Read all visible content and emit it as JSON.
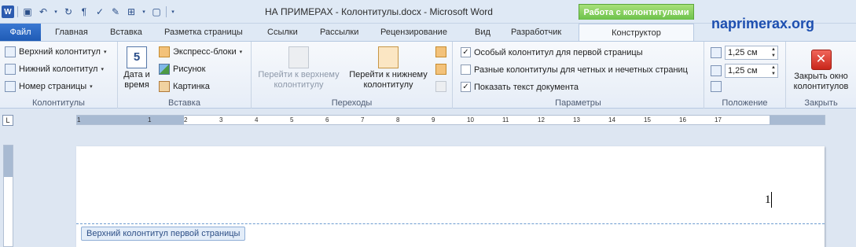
{
  "window": {
    "title": "НА ПРИМЕРАХ - Колонтитулы.docx  -  Microsoft Word",
    "context_tab_header": "Работа с колонтитулами",
    "brand": "naprimerax.org",
    "app_icon_letter": "W"
  },
  "tabs": {
    "file": "Файл",
    "items": [
      "Главная",
      "Вставка",
      "Разметка страницы",
      "Ссылки",
      "Рассылки",
      "Рецензирование",
      "Вид",
      "Разработчик",
      "Конструктор"
    ]
  },
  "ribbon": {
    "headers_footers": {
      "label": "Колонтитулы",
      "header": "Верхний колонтитул",
      "footer": "Нижний колонтитул",
      "page_number": "Номер страницы"
    },
    "insert": {
      "label": "Вставка",
      "date_time": "Дата и время",
      "date_time_line1": "Дата и",
      "date_time_line2": "время",
      "quick_parts": "Экспресс-блоки",
      "picture": "Рисунок",
      "clip_art": "Картинка",
      "calendar_number": "5"
    },
    "navigation": {
      "label": "Переходы",
      "goto_header_line1": "Перейти к верхнему",
      "goto_header_line2": "колонтитулу",
      "goto_footer_line1": "Перейти к нижнему",
      "goto_footer_line2": "колонтитулу"
    },
    "options": {
      "label": "Параметры",
      "different_first": "Особый колонтитул для первой страницы",
      "different_odd_even": "Разные колонтитулы для четных и нечетных страниц",
      "show_document_text": "Показать текст документа",
      "different_first_checked": true,
      "different_odd_even_checked": false,
      "show_document_text_checked": true
    },
    "position": {
      "label": "Положение",
      "header_from_top": "1,25 см",
      "footer_from_bottom": "1,25 см"
    },
    "close": {
      "label": "Закрыть",
      "button_line1": "Закрыть окно",
      "button_line2": "колонтитулов"
    }
  },
  "ruler": {
    "corner": "L",
    "ticks": [
      "1",
      "1",
      "2",
      "3",
      "4",
      "5",
      "6",
      "7",
      "8",
      "9",
      "10",
      "11",
      "12",
      "13",
      "14",
      "15",
      "16",
      "17"
    ]
  },
  "document": {
    "header_tag": "Верхний колонтитул первой страницы",
    "page_number": "1"
  },
  "colors": {
    "accent": "#1f5bb5",
    "context_tab": "#6cc24a",
    "brand": "#1d4fb0",
    "close_button": "#c9261b"
  }
}
